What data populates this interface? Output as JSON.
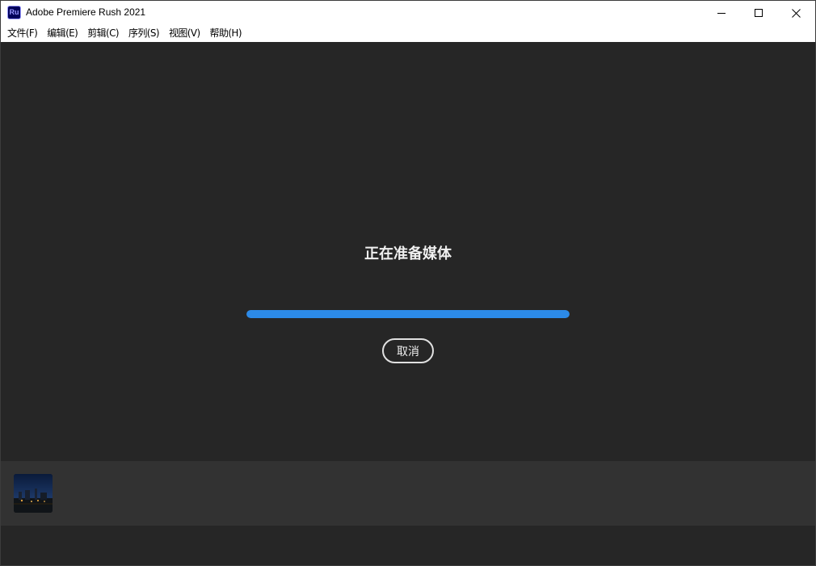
{
  "window": {
    "app_icon_text": "Ru",
    "title": "Adobe Premiere Rush 2021",
    "controls": [
      "minimize-icon",
      "maximize-icon",
      "close-icon"
    ]
  },
  "menu": {
    "items": [
      {
        "label": "文件(F)"
      },
      {
        "label": "编辑(E)"
      },
      {
        "label": "剪辑(C)"
      },
      {
        "label": "序列(S)"
      },
      {
        "label": "视图(V)"
      },
      {
        "label": "帮助(H)"
      }
    ]
  },
  "dialog": {
    "heading": "正在准备媒体",
    "progress_fraction": 1.0,
    "cancel_label": "取消"
  },
  "colors": {
    "accent": "#2c8ae8",
    "background": "#262626",
    "strip": "#323232"
  }
}
